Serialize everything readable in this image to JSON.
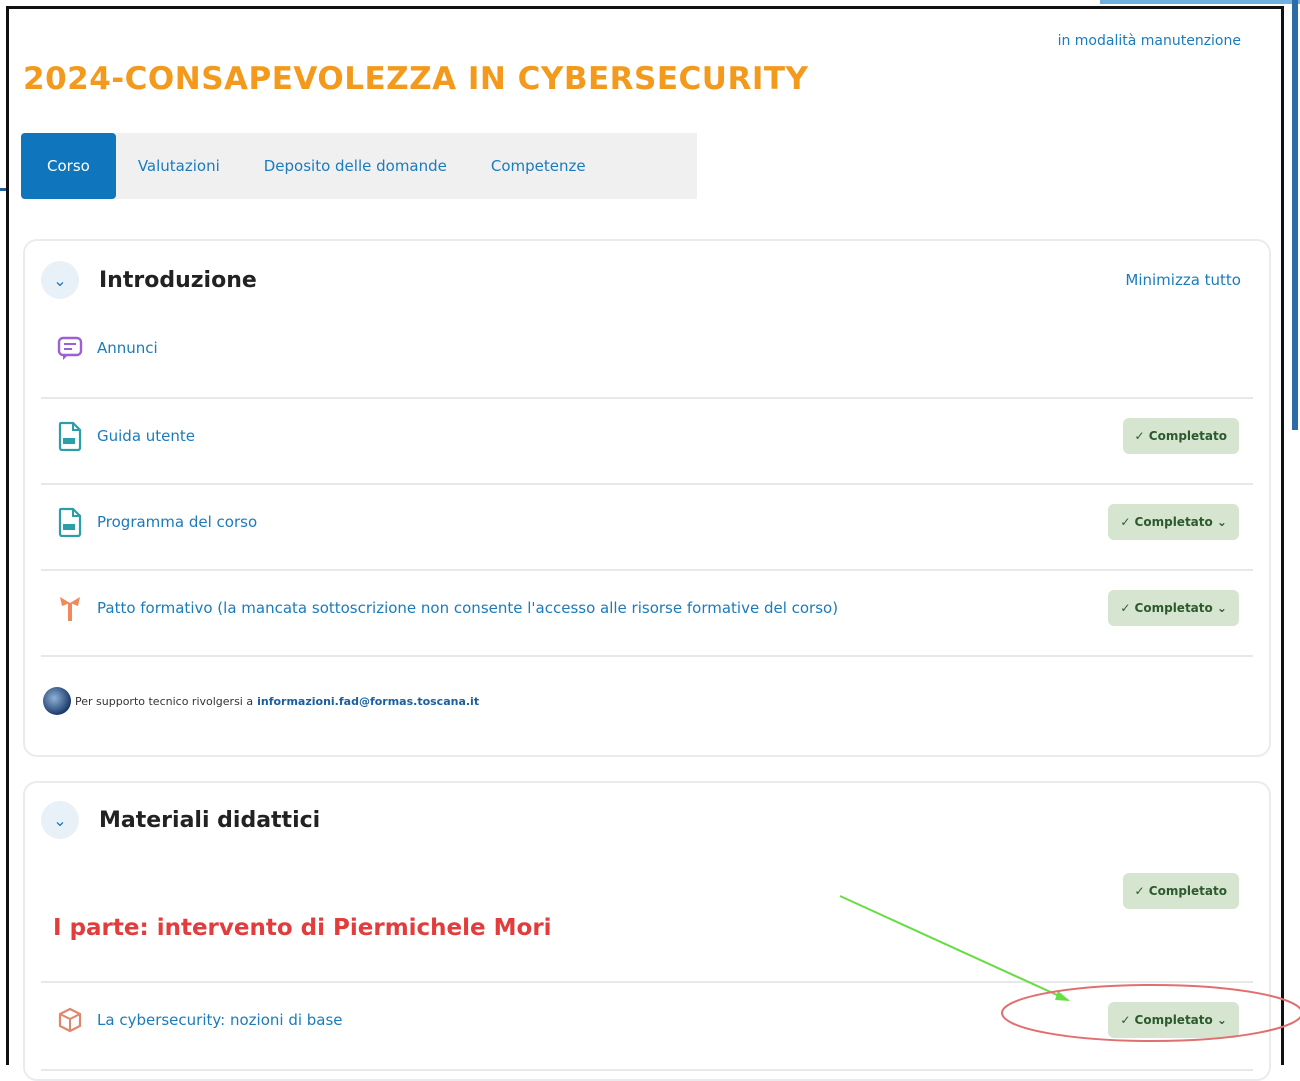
{
  "header": {
    "maintenance_note": "in modalità manutenzione",
    "course_title": "2024-CONSAPEVOLEZZA IN CYBERSECURITY"
  },
  "tabs": [
    {
      "label": "Corso",
      "active": true
    },
    {
      "label": "Valutazioni",
      "active": false
    },
    {
      "label": "Deposito delle domande",
      "active": false
    },
    {
      "label": "Competenze",
      "active": false
    }
  ],
  "section1": {
    "title": "Introduzione",
    "collapse_all": "Minimizza tutto",
    "activities": [
      {
        "name": "Annunci",
        "icon": "forum-icon",
        "status": ""
      },
      {
        "name": "Guida utente",
        "icon": "pdf-file-icon",
        "status": "✓ Completato"
      },
      {
        "name": "Programma del corso",
        "icon": "pdf-file-icon",
        "status": "✓ Completato ⌄"
      },
      {
        "name": "Patto formativo (la mancata sottoscrizione non consente l'accesso alle risorse formative del corso)",
        "icon": "feedback-icon",
        "status": "✓ Completato ⌄"
      }
    ],
    "support_text": "Per supporto tecnico rivolgersi a",
    "support_email": "informazioni.fad@formas.toscana.it"
  },
  "section2": {
    "title": "Materiali didattici",
    "section_status": "✓ Completato",
    "part_title": "I parte: intervento di Piermichele Mori",
    "activities": [
      {
        "name": "La cybersecurity: nozioni di base",
        "icon": "package-icon",
        "status": "✓ Completato ⌄"
      }
    ]
  },
  "colors": {
    "accent": "#0f75bc",
    "title": "#f39a1d",
    "badge_bg": "#d6e5d0",
    "part_title": "#e23c3c",
    "annotation_arrow": "#66dd44",
    "annotation_ellipse": "#e07070"
  }
}
